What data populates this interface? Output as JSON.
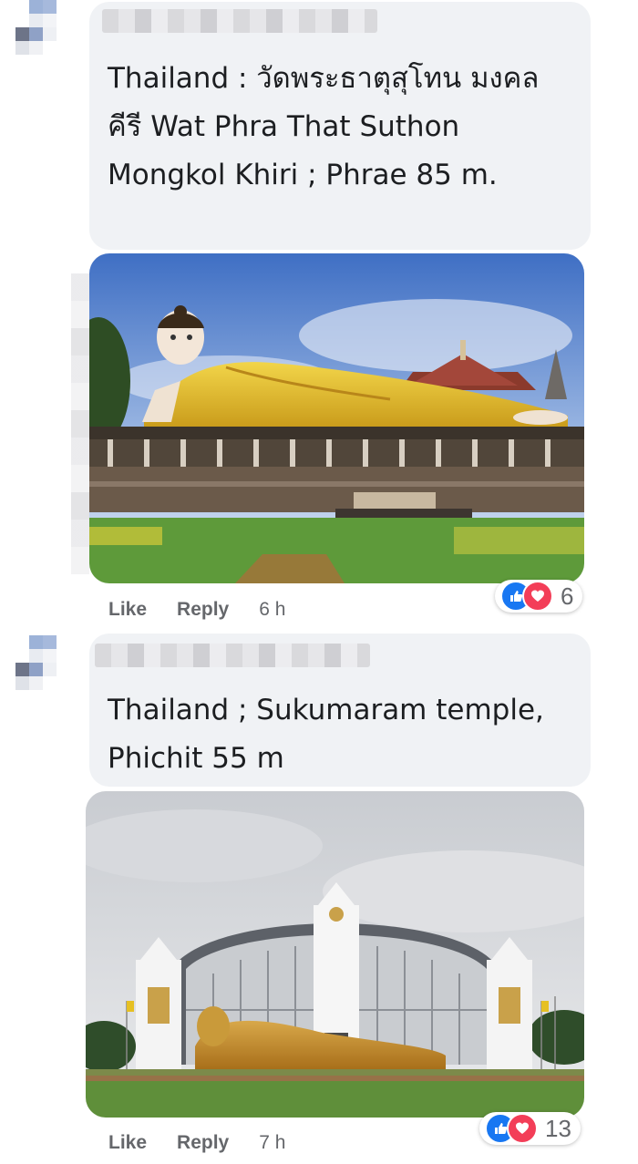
{
  "comments": [
    {
      "text": "Thailand : วัดพระธาตุสุโทน มงคลคีรี Wat Phra That Suthon Mongkol Khiri ; Phrae 85 m.",
      "actions": {
        "like": "Like",
        "reply": "Reply",
        "time": "6 h"
      },
      "reaction_count": "6",
      "photo_alt": "reclining-golden-buddha-temple"
    },
    {
      "text": "Thailand ; Sukumaram temple, Phichit 55 m",
      "actions": {
        "like": "Like",
        "reply": "Reply",
        "time": "7 h"
      },
      "reaction_count": "13",
      "photo_alt": "reclining-buddha-hall"
    }
  ],
  "colors": {
    "bubble": "#f0f2f5",
    "text": "#1c1e21",
    "meta": "#65676b",
    "like": "#1877f2",
    "love": "#f33e58"
  },
  "icons": [
    "like-reaction-icon",
    "love-reaction-icon"
  ]
}
